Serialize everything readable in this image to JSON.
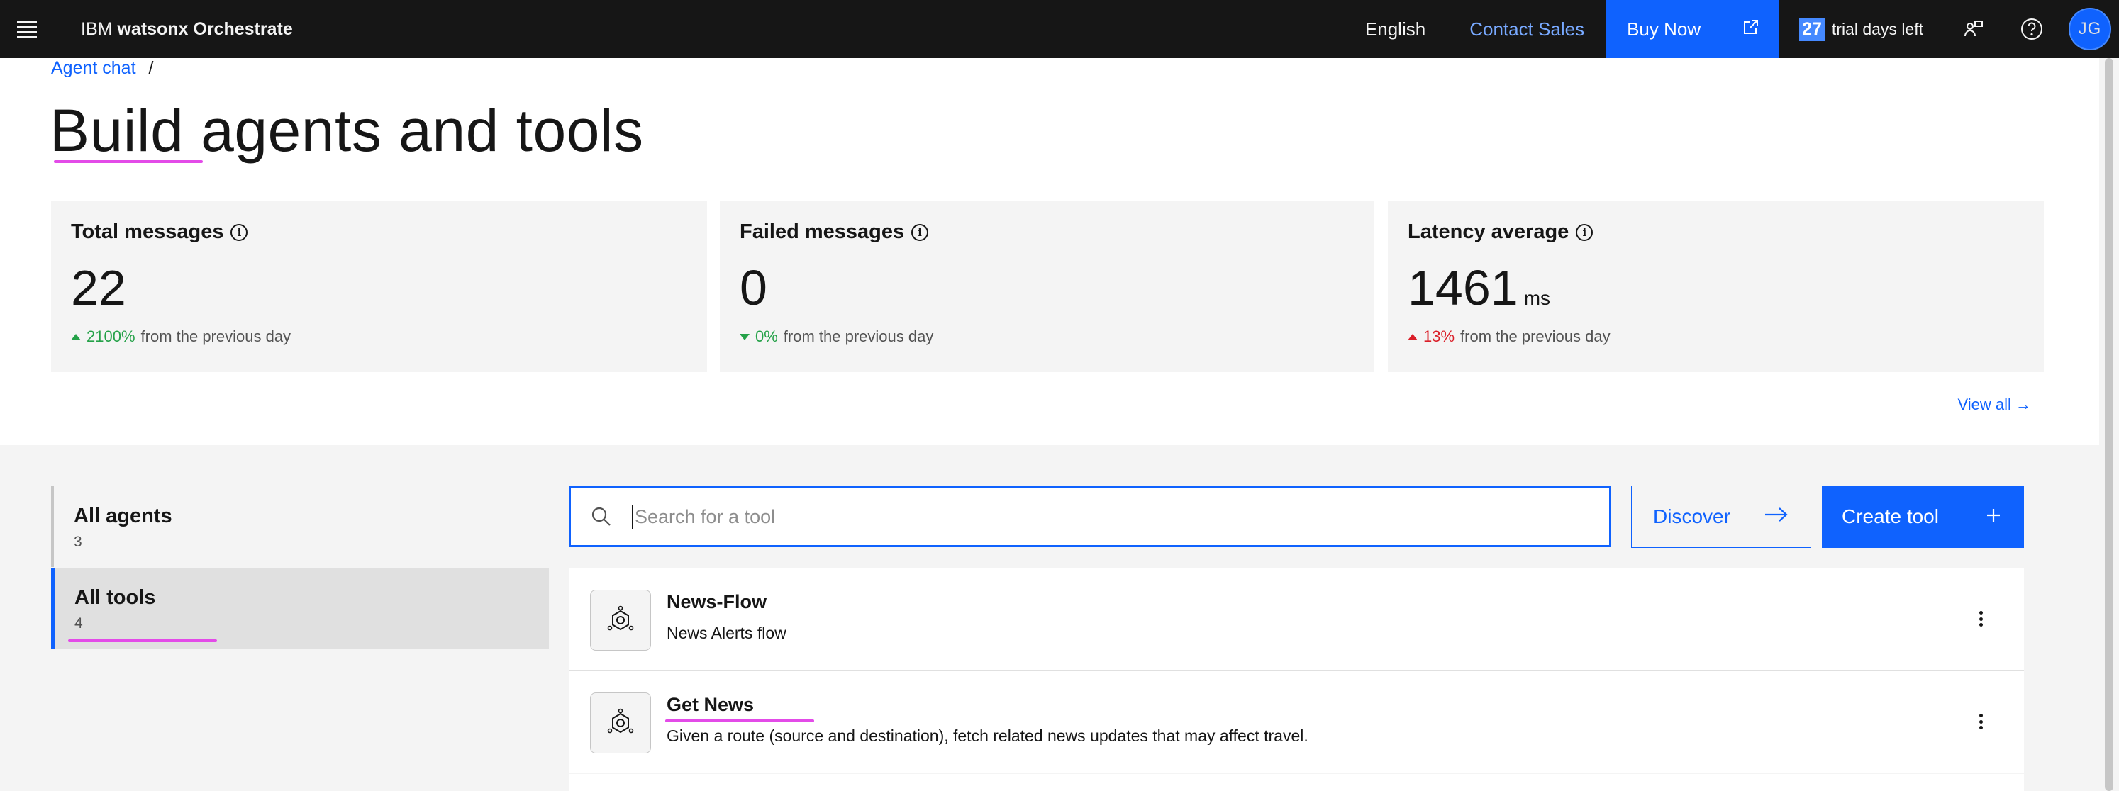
{
  "header": {
    "brand_prefix": "IBM ",
    "brand_product": "watsonx Orchestrate",
    "language": "English",
    "contact_sales": "Contact Sales",
    "buy_now": "Buy Now",
    "trial_days": "27",
    "trial_text": "trial days left",
    "avatar_initials": "JG"
  },
  "breadcrumb": {
    "parent": "Agent chat",
    "separator": "/"
  },
  "page_title": "Build agents and tools",
  "metrics": [
    {
      "title": "Total messages",
      "value": "22",
      "unit": "",
      "change": "2100%",
      "change_suffix": "from the previous day",
      "direction": "up",
      "status": "good"
    },
    {
      "title": "Failed messages",
      "value": "0",
      "unit": "",
      "change": "0%",
      "change_suffix": "from the previous day",
      "direction": "down",
      "status": "good"
    },
    {
      "title": "Latency average",
      "value": "1461",
      "unit": "ms",
      "change": "13%",
      "change_suffix": "from the previous day",
      "direction": "up",
      "status": "bad"
    }
  ],
  "view_all": "View all →",
  "sidebar": {
    "items": [
      {
        "label": "All agents",
        "count": "3",
        "active": false
      },
      {
        "label": "All tools",
        "count": "4",
        "active": true
      }
    ]
  },
  "search": {
    "placeholder": "Search for a tool",
    "value": ""
  },
  "actions": {
    "discover": "Discover",
    "create_tool": "Create tool"
  },
  "tools": [
    {
      "name": "News-Flow",
      "description": "News Alerts flow"
    },
    {
      "name": "Get News",
      "description": "Given a route (source and destination), fetch related news updates that may affect travel."
    }
  ],
  "colors": {
    "header_bg": "#161616",
    "primary": "#0f62fe",
    "link": "#78a9ff",
    "positive": "#24a148",
    "negative": "#da1e28",
    "annotation": "#e34be8"
  }
}
